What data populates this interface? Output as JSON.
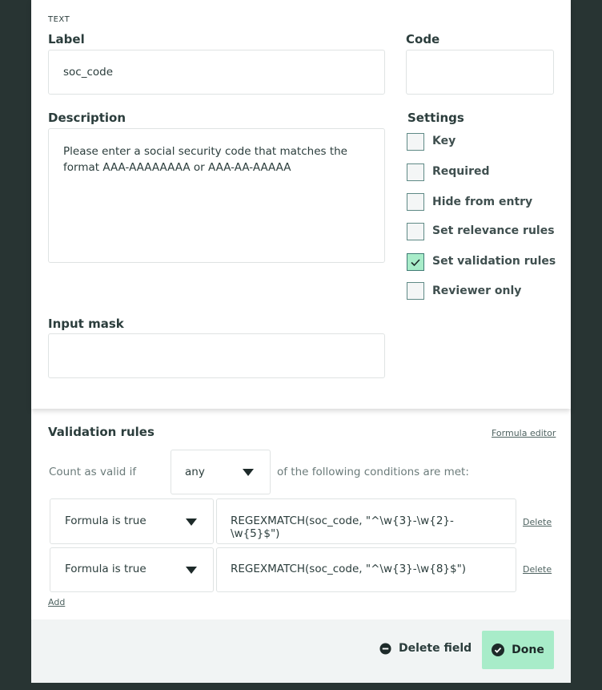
{
  "field_type": "TEXT",
  "label": {
    "title": "Label",
    "value": "soc_code"
  },
  "code": {
    "title": "Code",
    "value": ""
  },
  "description": {
    "title": "Description",
    "value": "Please enter a social security code that matches the format AAA-AAAAAAAA or AAA-AA-AAAAA"
  },
  "settings": {
    "title": "Settings",
    "items": [
      {
        "label": "Key",
        "checked": false
      },
      {
        "label": "Required",
        "checked": false
      },
      {
        "label": "Hide from entry",
        "checked": false
      },
      {
        "label": "Set relevance rules",
        "checked": false
      },
      {
        "label": "Set validation rules",
        "checked": true
      },
      {
        "label": "Reviewer only",
        "checked": false
      }
    ]
  },
  "input_mask": {
    "title": "Input mask",
    "value": ""
  },
  "validation": {
    "title": "Validation rules",
    "formula_editor": "Formula editor",
    "prefix": "Count as valid if",
    "mode": "any",
    "suffix": "of the following conditions are met:",
    "rules": [
      {
        "type": "Formula is true",
        "formula": "REGEXMATCH(soc_code, \"^\\w{3}-\\w{2}-\\w{5}$\")",
        "delete": "Delete"
      },
      {
        "type": "Formula is true",
        "formula": "REGEXMATCH(soc_code, \"^\\w{3}-\\w{8}$\")",
        "delete": "Delete"
      }
    ],
    "add": "Add"
  },
  "footer": {
    "delete_field": "Delete field",
    "done": "Done"
  },
  "colors": {
    "accent": "#a8ecc9",
    "background": "#283433"
  }
}
